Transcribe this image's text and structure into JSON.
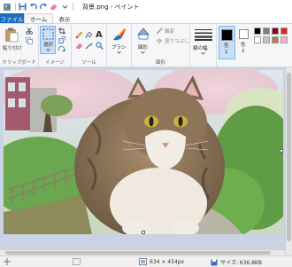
{
  "titlebar": {
    "title": "背景.png - ペイント"
  },
  "tabs": {
    "file": "ファイル",
    "home": "ホーム",
    "view": "表示"
  },
  "ribbon": {
    "clipboard": {
      "paste_label": "貼り付け",
      "group_label": "クリップボード"
    },
    "image": {
      "select_label": "選択",
      "group_label": "イメージ"
    },
    "tools": {
      "group_label": "ツール"
    },
    "brushes": {
      "label": "ブラシ"
    },
    "shapes": {
      "shapes_label": "図形",
      "outline_label": "輪郭",
      "fill_label": "塗りつぶし",
      "group_label": "図形"
    },
    "size": {
      "label": "線の幅"
    },
    "colors": {
      "color1_label": "色\n1",
      "color2_label": "色\n2",
      "color1": "#000000",
      "color2": "#ffffff",
      "palette_row1": [
        "#000000",
        "#7f7f7f",
        "#880015",
        "#ed1c24"
      ],
      "palette_row2": [
        "#ffffff",
        "#c3c3c3",
        "#b97a57",
        "#ffaec9"
      ]
    }
  },
  "status": {
    "dimensions": "634 × 454px",
    "size": "サイズ: 636.8KB"
  },
  "image": {
    "subject": "cat-photo"
  }
}
